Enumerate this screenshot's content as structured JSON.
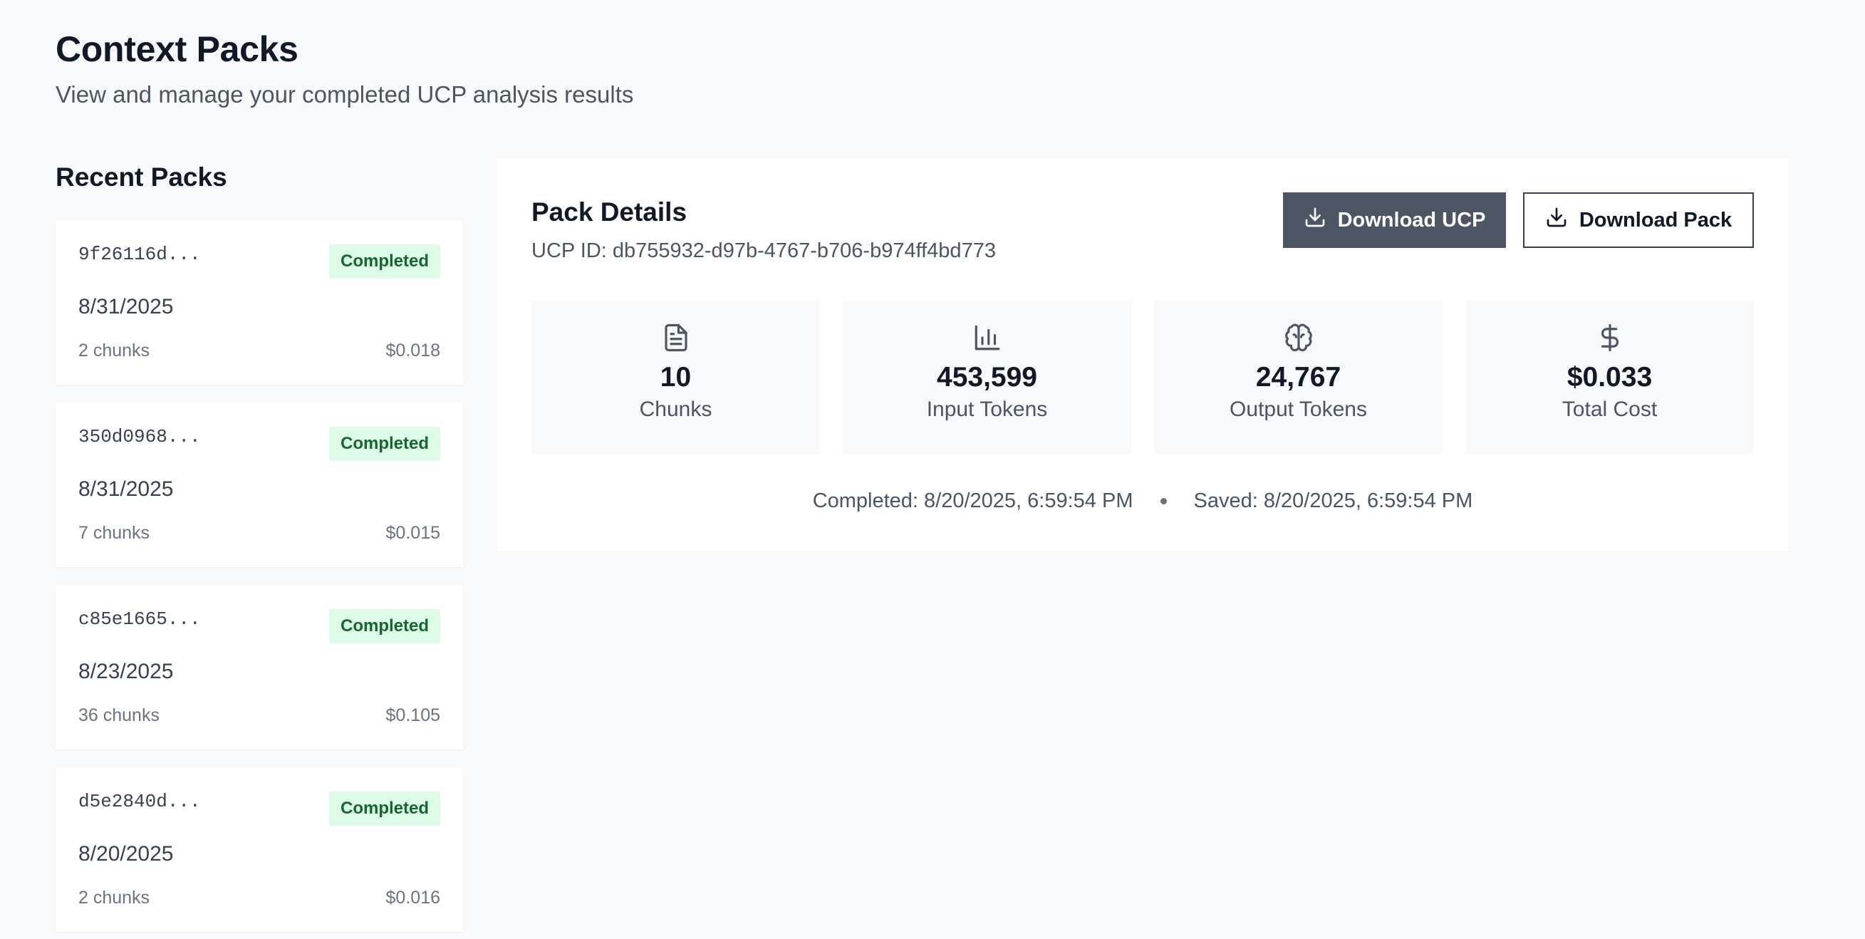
{
  "header": {
    "title": "Context Packs",
    "subtitle": "View and manage your completed UCP analysis results"
  },
  "recent_packs": {
    "title": "Recent Packs",
    "items": [
      {
        "id": "9f26116d...",
        "status": "Completed",
        "date": "8/31/2025",
        "chunks": "2 chunks",
        "cost": "$0.018"
      },
      {
        "id": "350d0968...",
        "status": "Completed",
        "date": "8/31/2025",
        "chunks": "7 chunks",
        "cost": "$0.015"
      },
      {
        "id": "c85e1665...",
        "status": "Completed",
        "date": "8/23/2025",
        "chunks": "36 chunks",
        "cost": "$0.105"
      },
      {
        "id": "d5e2840d...",
        "status": "Completed",
        "date": "8/20/2025",
        "chunks": "2 chunks",
        "cost": "$0.016"
      }
    ]
  },
  "details": {
    "title": "Pack Details",
    "ucp_id": "UCP ID: db755932-d97b-4767-b706-b974ff4bd773",
    "download_ucp_label": "Download UCP",
    "download_pack_label": "Download Pack",
    "stats": [
      {
        "icon": "document-icon",
        "value": "10",
        "label": "Chunks"
      },
      {
        "icon": "bar-chart-icon",
        "value": "453,599",
        "label": "Input Tokens"
      },
      {
        "icon": "brain-icon",
        "value": "24,767",
        "label": "Output Tokens"
      },
      {
        "icon": "dollar-icon",
        "value": "$0.033",
        "label": "Total Cost"
      }
    ],
    "completed": "Completed: 8/20/2025, 6:59:54 PM",
    "saved": "Saved: 8/20/2025, 6:59:54 PM"
  },
  "colors": {
    "background": "#f8f9fb",
    "card": "#ffffff",
    "primary_button": "#4b5563",
    "badge_bg": "#dcfce7",
    "badge_text": "#166534"
  }
}
